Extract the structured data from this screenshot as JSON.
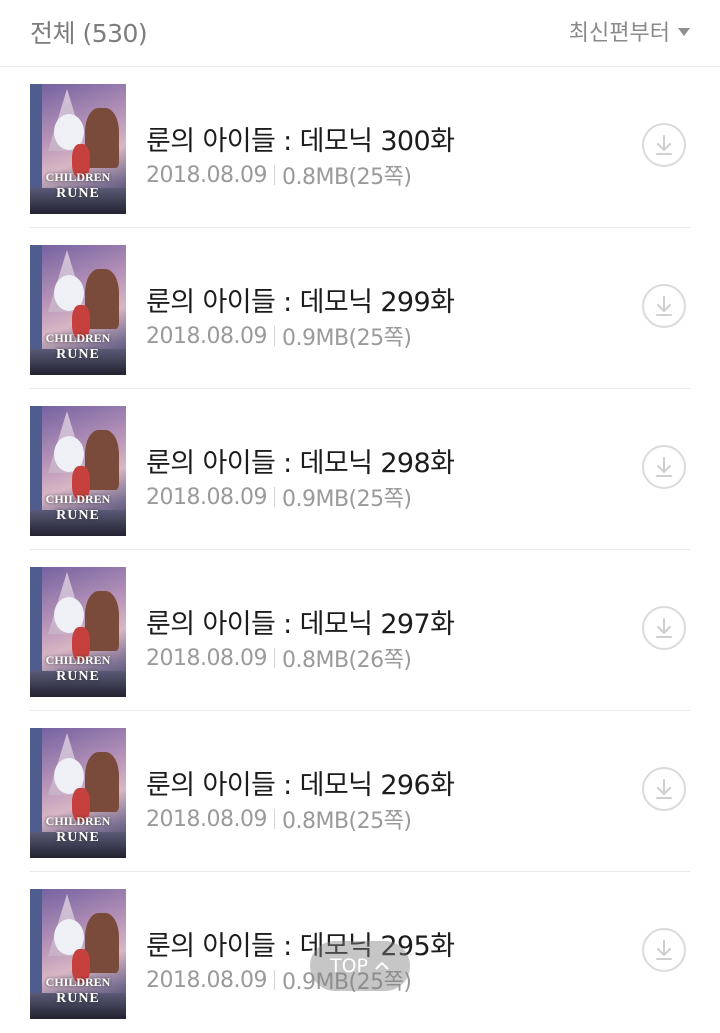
{
  "header": {
    "total": "전체 (530)",
    "sort": "최신편부터"
  },
  "cover": {
    "line1": "CHILDREN",
    "line2": "RUNE"
  },
  "episodes": [
    {
      "title": "룬의 아이들 : 데모닉 300화",
      "date": "2018.08.09",
      "size": "0.8MB(25쪽)"
    },
    {
      "title": "룬의 아이들 : 데모닉 299화",
      "date": "2018.08.09",
      "size": "0.9MB(25쪽)"
    },
    {
      "title": "룬의 아이들 : 데모닉 298화",
      "date": "2018.08.09",
      "size": "0.9MB(25쪽)"
    },
    {
      "title": "룬의 아이들 : 데모닉 297화",
      "date": "2018.08.09",
      "size": "0.8MB(26쪽)"
    },
    {
      "title": "룬의 아이들 : 데모닉 296화",
      "date": "2018.08.09",
      "size": "0.8MB(25쪽)"
    },
    {
      "title": "룬의 아이들 : 데모닉 295화",
      "date": "2018.08.09",
      "size": "0.9MB(25쪽)"
    }
  ],
  "top_button": {
    "label": "TOP",
    "icon": "chevron-up-icon"
  },
  "colors": {
    "title": "#1c1c1c",
    "meta": "#9a9a9a",
    "divider": "#e9e9e9"
  }
}
